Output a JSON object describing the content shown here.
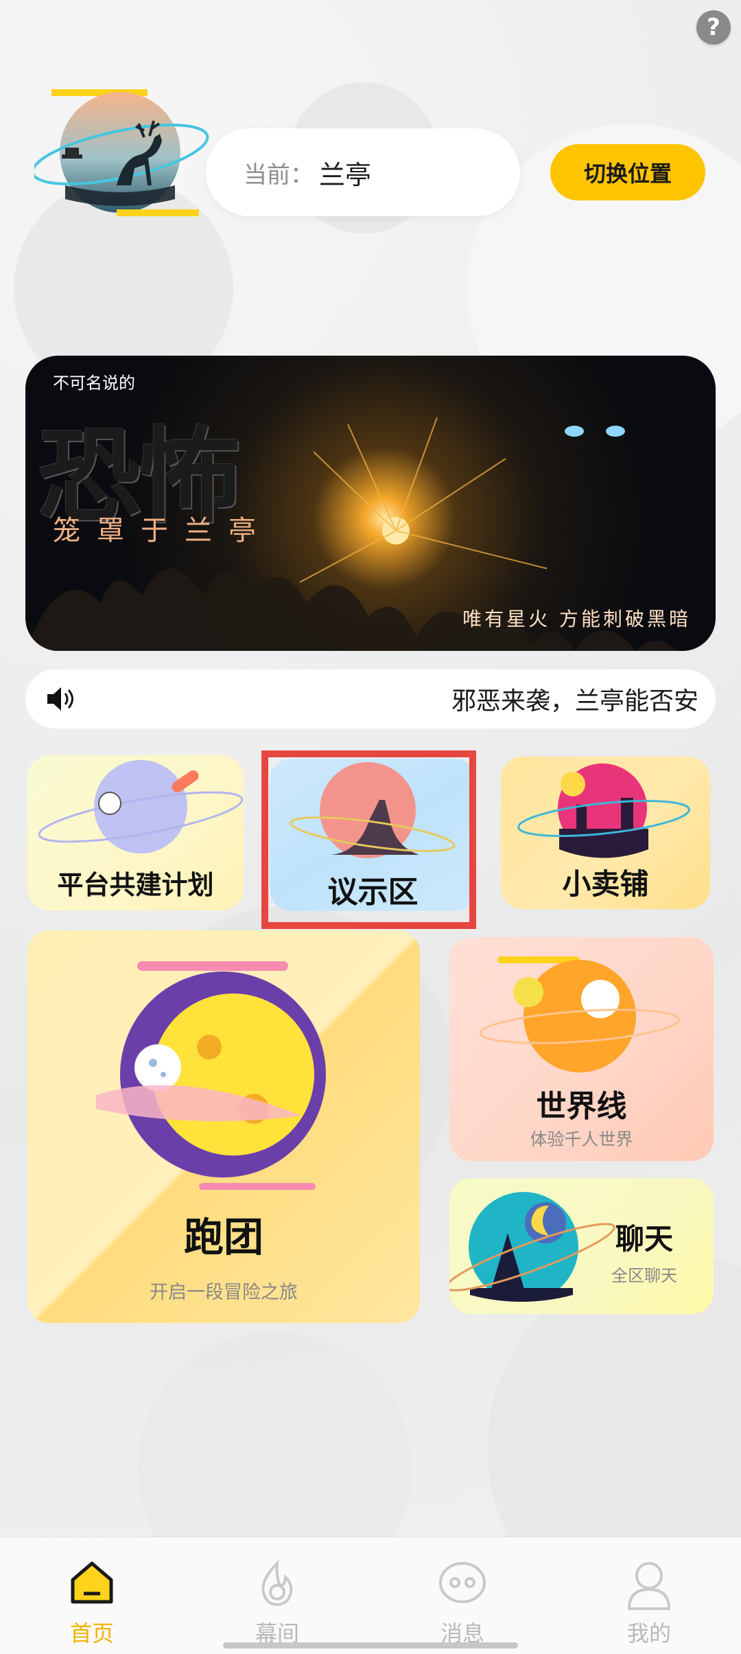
{
  "help": {
    "label": "?"
  },
  "header": {
    "location_prefix": "当前：",
    "location_value": "兰亭",
    "switch_button": "切换位置"
  },
  "banner": {
    "small_title": "不可名说的",
    "big_title": "恐怖",
    "subtitle": "笼罩于兰亭",
    "slogan": "唯有星火 方能刺破黑暗"
  },
  "notice": {
    "icon": "speaker-icon",
    "text": "邪恶来袭，兰亭能否安"
  },
  "tiles": {
    "platform": {
      "label": "平台共建计划",
      "icon": "astronaut-planet-icon"
    },
    "forum": {
      "label": "议示区",
      "icon": "mountain-planet-icon",
      "highlight_color": "#e5463f"
    },
    "shop": {
      "label": "小卖铺",
      "icon": "city-planet-icon"
    },
    "team": {
      "label": "跑团",
      "subtitle": "开启一段冒险之旅",
      "icon": "purple-moon-planet-icon"
    },
    "worldline": {
      "label": "世界线",
      "subtitle": "体验千人世界",
      "icon": "orange-planet-icon"
    },
    "chat": {
      "label": "聊天",
      "subtitle": "全区聊天",
      "icon": "forest-planet-icon"
    }
  },
  "nav": [
    {
      "label": "首页",
      "icon": "home-icon",
      "active": true
    },
    {
      "label": "幕间",
      "icon": "flame-icon",
      "active": false
    },
    {
      "label": "消息",
      "icon": "message-face-icon",
      "active": false
    },
    {
      "label": "我的",
      "icon": "profile-icon",
      "active": false
    }
  ],
  "colors": {
    "accent": "#ffc400",
    "active_nav": "#f0b400",
    "highlight": "#e5463f"
  }
}
